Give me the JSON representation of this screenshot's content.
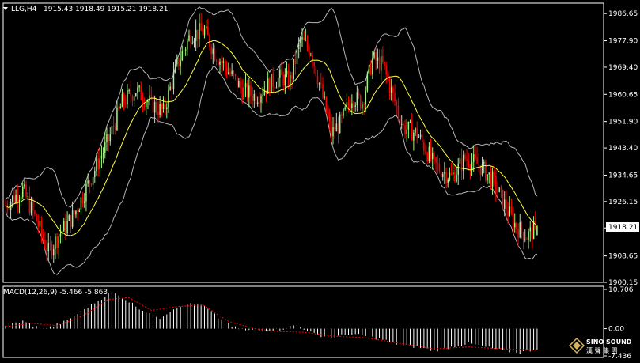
{
  "header": {
    "symbol": "LLG,H4",
    "ohlc": "1915.43 1918.49 1915.21 1918.21"
  },
  "macd_header": {
    "label": "MACD(12,26,9) -5.466 -5.863"
  },
  "price_axis": {
    "ticks": [
      "1986.65",
      "1977.90",
      "1969.40",
      "1960.65",
      "1951.90",
      "1943.40",
      "1934.65",
      "1926.15",
      "1917.65",
      "1908.65",
      "1900.15"
    ],
    "current_price": "1918.21"
  },
  "macd_axis": {
    "ticks": [
      "10.706",
      "0.00",
      "-7.436"
    ]
  },
  "logo": {
    "name": "SINO SOUND",
    "sub": "漢 聲 集 團"
  },
  "colors": {
    "bull": "#a8f08a",
    "bear": "#ff0000",
    "ma": "#ffff44",
    "bands": "#b4b4b4",
    "macd_hist": "#ffffff",
    "macd_signal": "#ff0000",
    "frame": "#ffffff",
    "background": "#000000"
  },
  "chart_data": {
    "type": "candlestick",
    "price_range": [
      1900.15,
      1990
    ],
    "macd_range": [
      -7.436,
      10.706
    ],
    "price_path": [
      [
        0,
        1925
      ],
      [
        10,
        1930
      ],
      [
        18,
        1920
      ],
      [
        25,
        1910
      ],
      [
        32,
        1916
      ],
      [
        40,
        1922
      ],
      [
        50,
        1934
      ],
      [
        60,
        1946
      ],
      [
        68,
        1958
      ],
      [
        76,
        1962
      ],
      [
        84,
        1958
      ],
      [
        92,
        1955
      ],
      [
        100,
        1970
      ],
      [
        108,
        1980
      ],
      [
        116,
        1981
      ],
      [
        122,
        1974
      ],
      [
        130,
        1968
      ],
      [
        138,
        1962
      ],
      [
        146,
        1960
      ],
      [
        154,
        1964
      ],
      [
        160,
        1966
      ],
      [
        166,
        1965
      ],
      [
        172,
        1978
      ],
      [
        178,
        1975
      ],
      [
        184,
        1962
      ],
      [
        190,
        1948
      ],
      [
        196,
        1952
      ],
      [
        202,
        1960
      ],
      [
        208,
        1958
      ],
      [
        214,
        1972
      ],
      [
        220,
        1970
      ],
      [
        226,
        1960
      ],
      [
        232,
        1950
      ],
      [
        240,
        1948
      ],
      [
        250,
        1938
      ],
      [
        260,
        1934
      ],
      [
        268,
        1940
      ],
      [
        276,
        1938
      ],
      [
        284,
        1933
      ],
      [
        292,
        1924
      ],
      [
        298,
        1918
      ],
      [
        304,
        1915
      ],
      [
        310,
        1918
      ]
    ],
    "macd_path": [
      [
        0,
        1
      ],
      [
        10,
        2
      ],
      [
        18,
        0.5
      ],
      [
        25,
        0.2
      ],
      [
        35,
        2
      ],
      [
        45,
        5
      ],
      [
        55,
        8
      ],
      [
        62,
        10
      ],
      [
        70,
        8
      ],
      [
        80,
        5
      ],
      [
        90,
        3
      ],
      [
        100,
        6
      ],
      [
        108,
        7
      ],
      [
        116,
        6
      ],
      [
        124,
        3
      ],
      [
        132,
        0.5
      ],
      [
        140,
        -0.5
      ],
      [
        150,
        -0.5
      ],
      [
        160,
        -0.2
      ],
      [
        170,
        1
      ],
      [
        180,
        -1.5
      ],
      [
        190,
        -2.5
      ],
      [
        200,
        -1.5
      ],
      [
        210,
        -2
      ],
      [
        220,
        -3
      ],
      [
        230,
        -4.5
      ],
      [
        240,
        -5
      ],
      [
        250,
        -6
      ],
      [
        260,
        -5
      ],
      [
        270,
        -4
      ],
      [
        280,
        -5
      ],
      [
        290,
        -6
      ],
      [
        300,
        -6.5
      ],
      [
        310,
        -5.5
      ]
    ],
    "signal_path": [
      [
        0,
        0.5
      ],
      [
        15,
        1.5
      ],
      [
        30,
        0.8
      ],
      [
        45,
        3.5
      ],
      [
        60,
        8
      ],
      [
        72,
        8.5
      ],
      [
        85,
        5
      ],
      [
        100,
        6
      ],
      [
        115,
        6.5
      ],
      [
        130,
        2
      ],
      [
        145,
        0
      ],
      [
        160,
        -0.8
      ],
      [
        175,
        -1
      ],
      [
        190,
        -2
      ],
      [
        210,
        -2.5
      ],
      [
        230,
        -4
      ],
      [
        250,
        -5.5
      ],
      [
        270,
        -5
      ],
      [
        290,
        -5.5
      ],
      [
        310,
        -5.8
      ]
    ]
  }
}
